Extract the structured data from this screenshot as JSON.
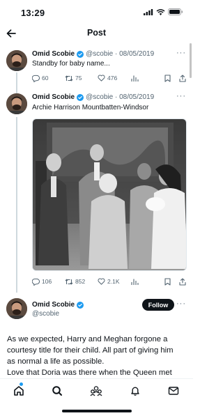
{
  "status_bar": {
    "time": "13:29"
  },
  "nav": {
    "title": "Post"
  },
  "tweets": [
    {
      "name": "Omid Scobie",
      "handle": "@scobie",
      "date": "08/05/2019",
      "text": "Standby for baby name...",
      "replies": "60",
      "reposts": "75",
      "likes": "476"
    },
    {
      "name": "Omid Scobie",
      "handle": "@scobie",
      "date": "08/05/2019",
      "text": "Archie Harrison Mountbatten-Windsor",
      "replies": "106",
      "reposts": "852",
      "likes": "2.1K"
    }
  ],
  "main_tweet": {
    "name": "Omid Scobie",
    "handle": "@scobie",
    "follow_label": "Follow",
    "lines": [
      "As we expected, Harry and Meghan forgone a",
      "courtesy title for their child. All part of giving him",
      "as normal a life as possible.",
      "Love that Doria was there when the Queen met"
    ]
  },
  "colors": {
    "accent": "#1d9bf0",
    "text": "#0f1419",
    "muted": "#536471"
  },
  "icons": [
    "back-arrow-icon",
    "verified-badge-icon",
    "more-icon",
    "reply-icon",
    "repost-icon",
    "like-icon",
    "views-icon",
    "bookmark-icon",
    "share-icon",
    "home-icon",
    "search-icon",
    "communities-icon",
    "notifications-icon",
    "messages-icon"
  ]
}
